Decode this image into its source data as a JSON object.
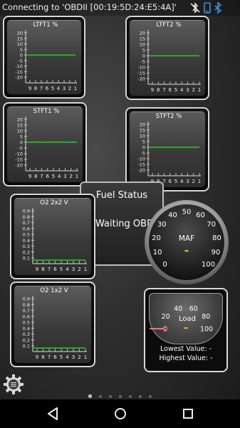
{
  "status_bar": {
    "connection_text": "Connecting to 'OBDII [00:19:5D:24:E5:4A]'",
    "icons": [
      "bluetooth-off-icon",
      "phone-icon",
      "bluetooth-icon"
    ]
  },
  "bar_gauges": [
    {
      "id": "ltft1",
      "title": "LTFT1  %",
      "y_ticks": [
        "20",
        "15",
        "10",
        "5",
        "0",
        "-5",
        "-10",
        "-15",
        "-20"
      ],
      "x_ticks": [
        "9",
        "8",
        "7",
        "6",
        "5",
        "4",
        "3",
        "2",
        "1"
      ],
      "line_value": 0,
      "ylim": [
        -20,
        20
      ]
    },
    {
      "id": "ltft2",
      "title": "LTFT2  %",
      "y_ticks": [
        "20",
        "15",
        "10",
        "5",
        "0",
        "-5",
        "-10",
        "-15",
        "-20"
      ],
      "x_ticks": [
        "9",
        "8",
        "7",
        "6",
        "5",
        "4",
        "3",
        "2",
        "1"
      ],
      "line_value": 0,
      "ylim": [
        -20,
        20
      ]
    },
    {
      "id": "stft1",
      "title": "STFT1  %",
      "y_ticks": [
        "20",
        "15",
        "10",
        "5",
        "0",
        "-5",
        "-10",
        "-15",
        "-20"
      ],
      "x_ticks": [
        "9",
        "8",
        "7",
        "6",
        "5",
        "4",
        "3",
        "2",
        "1"
      ],
      "line_value": 0,
      "ylim": [
        -20,
        20
      ]
    },
    {
      "id": "stft2",
      "title": "STFT2  %",
      "y_ticks": [
        "20",
        "15",
        "10",
        "5",
        "0",
        "-5",
        "-10",
        "-15",
        "-20"
      ],
      "x_ticks": [
        "9",
        "8",
        "7",
        "6",
        "5",
        "4",
        "3",
        "2",
        "1"
      ],
      "line_value": 0,
      "ylim": [
        -20,
        20
      ]
    },
    {
      "id": "o2_2x2",
      "title": "O2 2x2  V",
      "y_ticks": [
        "0.9",
        "0.8",
        "0.7",
        "0.6",
        "0.5",
        "0.4",
        "0.3",
        "0.2",
        "0.1"
      ],
      "x_ticks": [
        "9",
        "8",
        "7",
        "6",
        "5",
        "4",
        "3",
        "2",
        "1"
      ],
      "line_value": 0,
      "ylim": [
        0,
        0.9
      ]
    },
    {
      "id": "o2_1x2",
      "title": "O2 1x2  V",
      "y_ticks": [
        "0.9",
        "0.8",
        "0.7",
        "0.6",
        "0.5",
        "0.4",
        "0.3",
        "0.2",
        "0.1"
      ],
      "x_ticks": [
        "9",
        "8",
        "7",
        "6",
        "5",
        "4",
        "3",
        "2",
        "1"
      ],
      "line_value": 0,
      "ylim": [
        0,
        0.9
      ]
    }
  ],
  "fuel_status": {
    "title": "Fuel Status",
    "value": "Waiting OBD"
  },
  "maf_gauge": {
    "title": "MAF",
    "ticks": [
      "0",
      "10",
      "20",
      "30",
      "40",
      "50",
      "60",
      "70",
      "80",
      "90",
      "100"
    ],
    "value": 0,
    "range": [
      0,
      100
    ]
  },
  "load_gauge": {
    "title": "Load",
    "ticks": [
      "0",
      "20",
      "40",
      "60",
      "80",
      "100"
    ],
    "value": 0,
    "range": [
      0,
      100
    ],
    "lowest_label": "Lowest Value: -",
    "highest_label": "Highest Value: -"
  },
  "pager": {
    "count": 7,
    "active": 0
  },
  "colors": {
    "trace": "#22cc22",
    "needle": "#e03030",
    "marker": "#e0c000"
  }
}
